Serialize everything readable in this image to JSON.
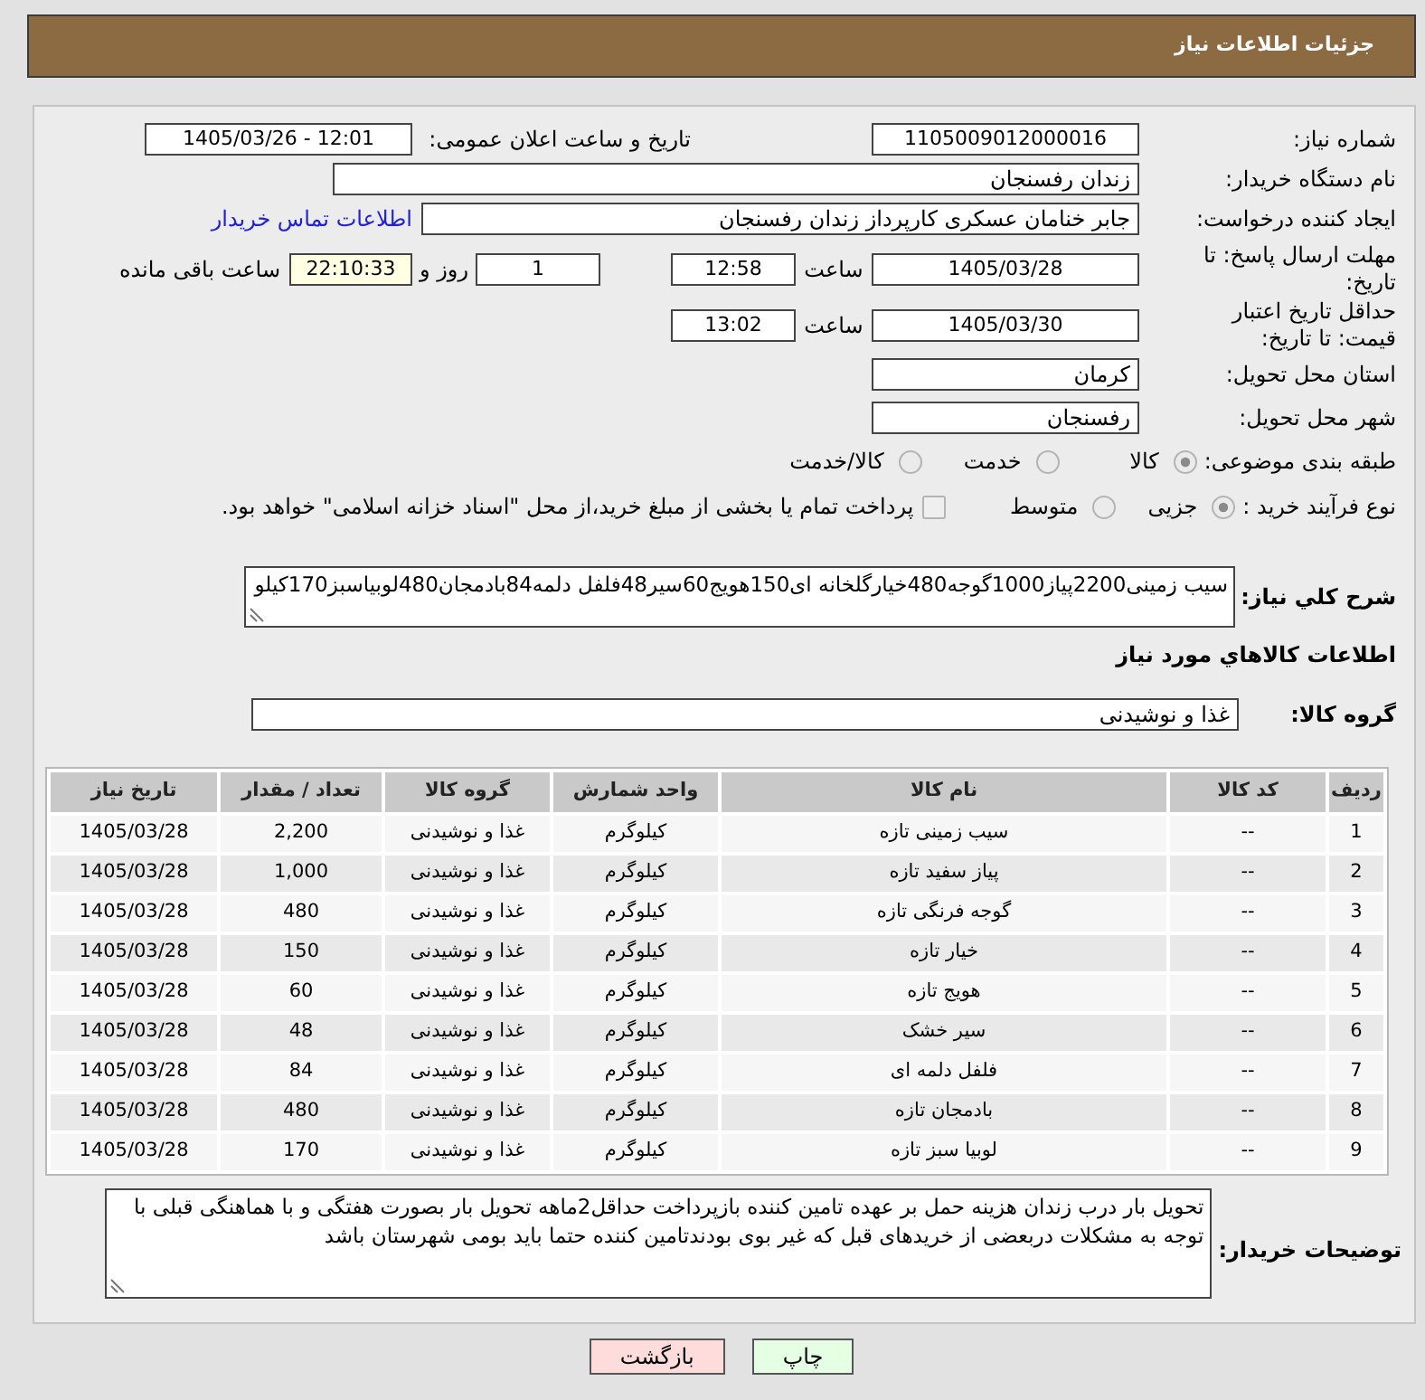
{
  "header": {
    "title": "جزئیات اطلاعات نیاز"
  },
  "need_number": {
    "label": "شماره نیاز:",
    "value": "1105009012000016"
  },
  "announcement": {
    "label": "تاریخ و ساعت اعلان عمومی:",
    "value": "1405/03/26 - 12:01"
  },
  "buyer_organization": {
    "label": "نام دستگاه خریدار:",
    "value": "زندان رفسنجان"
  },
  "requester": {
    "label": "ایجاد کننده درخواست:",
    "value": "جابر خنامان عسکری کارپرداز زندان رفسنجان",
    "contact_link": "اطلاعات تماس خریدار"
  },
  "response_deadline": {
    "label": "مهلت ارسال پاسخ: تا تاریخ:",
    "date": "1405/03/28",
    "time_label": "ساعت",
    "time": "12:58",
    "days": "1",
    "days_label": "روز و",
    "remaining": "22:10:33",
    "remaining_label": "ساعت باقی مانده"
  },
  "price_validity": {
    "label": "حداقل تاریخ اعتبار قیمت: تا تاریخ:",
    "date": "1405/03/30",
    "time_label": "ساعت",
    "time": "13:02"
  },
  "delivery_province": {
    "label": "استان محل تحویل:",
    "value": "کرمان"
  },
  "delivery_city": {
    "label": "شهر محل تحویل:",
    "value": "رفسنجان"
  },
  "subject_category": {
    "label": "طبقه بندی موضوعی:",
    "options": [
      {
        "label": "کالا",
        "selected": true
      },
      {
        "label": "خدمت",
        "selected": false
      },
      {
        "label": "کالا/خدمت",
        "selected": false
      }
    ]
  },
  "purchase_process": {
    "label": "نوع فرآیند خرید :",
    "options": [
      {
        "label": "جزیی",
        "selected": true
      },
      {
        "label": "متوسط",
        "selected": false
      }
    ],
    "treasury_payment": {
      "label": "پرداخت تمام یا بخشی از مبلغ خرید،از محل \"اسناد خزانه اسلامی\" خواهد بود.",
      "checked": false
    }
  },
  "description": {
    "label": "شرح کلي نياز:",
    "value": "سیب زمینی2200پیاز1000گوجه480خیارگلخانه ای150هویج60سیر48فلفل دلمه84بادمجان480لوبیاسبز170کیلو"
  },
  "goods_section": {
    "title": "اطلاعات کالاهاي مورد نياز"
  },
  "goods_group": {
    "label": "گروه کالا:",
    "value": "غذا و نوشیدنی"
  },
  "table": {
    "columns": [
      "ردیف",
      "کد کالا",
      "نام کالا",
      "واحد شمارش",
      "گروه کالا",
      "تعداد / مقدار",
      "تاریخ نیاز"
    ],
    "rows": [
      [
        "1",
        "--",
        "سیب زمینی تازه",
        "کیلوگرم",
        "غذا و نوشیدنی",
        "2,200",
        "1405/03/28"
      ],
      [
        "2",
        "--",
        "پیاز سفید تازه",
        "کیلوگرم",
        "غذا و نوشیدنی",
        "1,000",
        "1405/03/28"
      ],
      [
        "3",
        "--",
        "گوجه فرنگی تازه",
        "کیلوگرم",
        "غذا و نوشیدنی",
        "480",
        "1405/03/28"
      ],
      [
        "4",
        "--",
        "خیار تازه",
        "کیلوگرم",
        "غذا و نوشیدنی",
        "150",
        "1405/03/28"
      ],
      [
        "5",
        "--",
        "هویج تازه",
        "کیلوگرم",
        "غذا و نوشیدنی",
        "60",
        "1405/03/28"
      ],
      [
        "6",
        "--",
        "سیر خشک",
        "کیلوگرم",
        "غذا و نوشیدنی",
        "48",
        "1405/03/28"
      ],
      [
        "7",
        "--",
        "فلفل دلمه ای",
        "کیلوگرم",
        "غذا و نوشیدنی",
        "84",
        "1405/03/28"
      ],
      [
        "8",
        "--",
        "بادمجان تازه",
        "کیلوگرم",
        "غذا و نوشیدنی",
        "480",
        "1405/03/28"
      ],
      [
        "9",
        "--",
        "لوبیا سبز تازه",
        "کیلوگرم",
        "غذا و نوشیدنی",
        "170",
        "1405/03/28"
      ]
    ]
  },
  "buyer_notes": {
    "label": "توضیحات خریدار:",
    "value": "تحویل بار درب زندان هزینه حمل بر عهده تامین کننده بازپرداخت حداقل2ماهه تحویل بار بصورت هفتگی و با هماهنگی قبلی با توجه به مشکلات دربعضی از خریدهای قبل که غیر بوی بودندتامین کننده حتما باید بومی شهرستان باشد"
  },
  "buttons": [
    {
      "label": "چاپ",
      "kind": "print"
    },
    {
      "label": "بازگشت",
      "kind": "back"
    }
  ]
}
